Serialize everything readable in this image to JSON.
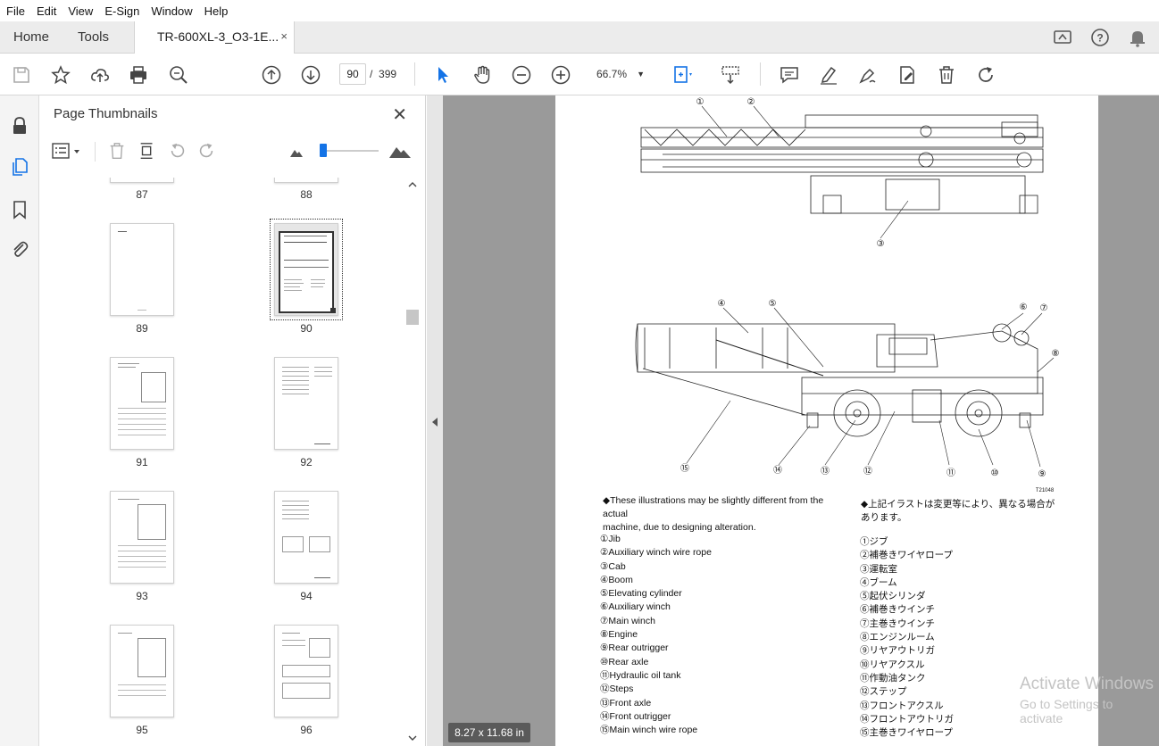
{
  "menu": [
    "File",
    "Edit",
    "View",
    "E-Sign",
    "Window",
    "Help"
  ],
  "tabs": {
    "home": "Home",
    "tools": "Tools",
    "document": "TR-600XL-3_O3-1E...",
    "close": "×"
  },
  "toolbar": {
    "page_current": "90",
    "page_separator": "/",
    "page_total": "399",
    "zoom": "66.7%"
  },
  "panel": {
    "title": "Page Thumbnails",
    "thumbnails": [
      {
        "label": "87"
      },
      {
        "label": "88"
      },
      {
        "label": "89"
      },
      {
        "label": "90"
      },
      {
        "label": "91"
      },
      {
        "label": "92"
      },
      {
        "label": "93"
      },
      {
        "label": "94"
      },
      {
        "label": "95"
      },
      {
        "label": "96"
      }
    ]
  },
  "document": {
    "page_size": "8.27 x 11.68 in",
    "figure_id": "T21048",
    "callouts_top": [
      "①",
      "②",
      "③"
    ],
    "callouts_side": [
      "④",
      "⑤",
      "⑥",
      "⑦",
      "⑧",
      "⑨",
      "⑩",
      "⑪",
      "⑫",
      "⑬",
      "⑭",
      "⑮"
    ],
    "note_en_1": "◆These illustrations may be slightly different from the actual",
    "note_en_2": "machine, due to designing alteration.",
    "note_jp_1": "◆上記イラストは変更等により、異なる場合が",
    "note_jp_2": "あります。",
    "parts_en": [
      "①Jib",
      "②Auxiliary winch wire rope",
      "③Cab",
      "④Boom",
      "⑤Elevating cylinder",
      "⑥Auxiliary winch",
      "⑦Main winch",
      "⑧Engine",
      "⑨Rear outrigger",
      "⑩Rear axle",
      "⑪Hydraulic oil tank",
      "⑫Steps",
      "⑬Front axle",
      "⑭Front outrigger",
      "⑮Main winch wire rope"
    ],
    "parts_jp": [
      "①ジブ",
      "②補巻きワイヤロープ",
      "③運転室",
      "④ブーム",
      "⑤起伏シリンダ",
      "⑥補巻きウインチ",
      "⑦主巻きウインチ",
      "⑧エンジンルーム",
      "⑨リヤアウトリガ",
      "⑩リヤアクスル",
      "⑪作動油タンク",
      "⑫ステップ",
      "⑬フロントアクスル",
      "⑭フロントアウトリガ",
      "⑮主巻きワイヤロープ"
    ]
  },
  "watermark": {
    "line1": "Activate Windows",
    "line2": "Go to Settings to activate"
  },
  "colors": {
    "accent": "#1473e6",
    "doc_bg": "#9a9a9a"
  }
}
